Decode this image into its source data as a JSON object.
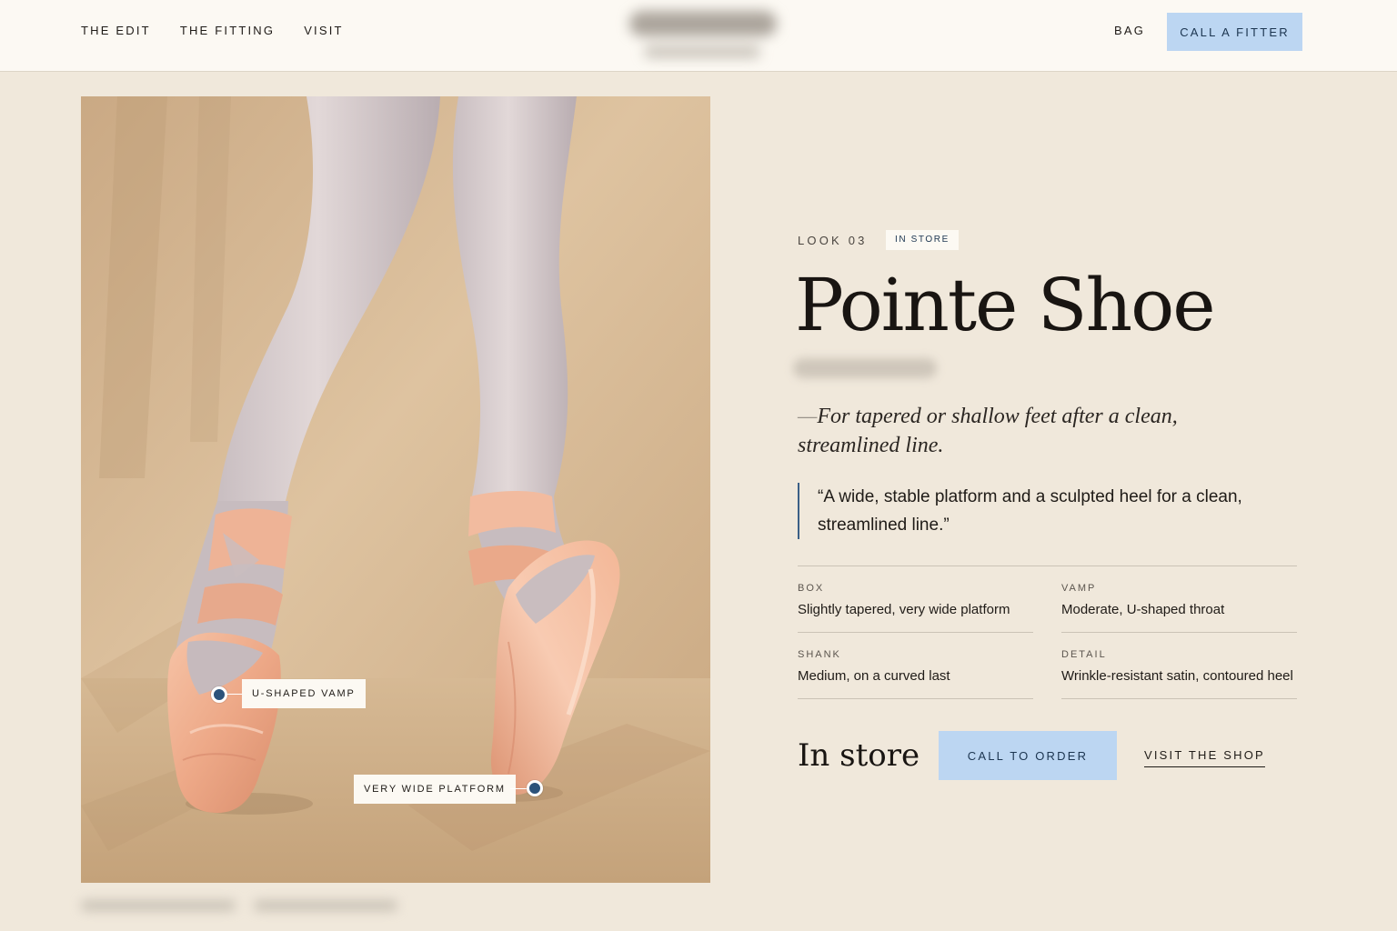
{
  "nav": {
    "items": [
      {
        "label": "THE EDIT"
      },
      {
        "label": "THE FITTING"
      },
      {
        "label": "VISIT"
      }
    ],
    "bag_label": "BAG",
    "fitter_label": "CALL A FITTER"
  },
  "photo": {
    "callouts": {
      "vamp": "U-SHAPED VAMP",
      "platform": "VERY WIDE PLATFORM"
    }
  },
  "product": {
    "eyebrow": "LOOK 03",
    "badge": "IN STORE",
    "title": "Pointe Shoe",
    "tagline_dash": "—",
    "tagline": "For tapered or shallow feet after a clean, streamlined line.",
    "quote": "“A wide, stable platform and a sculpted heel for a clean, streamlined line.”",
    "specs": [
      {
        "label": "BOX",
        "value": "Slightly tapered, very wide platform"
      },
      {
        "label": "VAMP",
        "value": "Moderate, U-shaped throat"
      },
      {
        "label": "SHANK",
        "value": "Medium, on a curved last"
      },
      {
        "label": "DETAIL",
        "value": "Wrinkle-resistant satin, contoured heel"
      }
    ],
    "availability": "In store",
    "order_label": "CALL TO ORDER",
    "shop_label": "VISIT THE SHOP"
  },
  "colors": {
    "background": "#f0e8db",
    "header": "#fcf9f3",
    "button": "#bcd6f2",
    "button_text": "#1c3550",
    "accent": "#2c527a",
    "text": "#1f1b17"
  }
}
